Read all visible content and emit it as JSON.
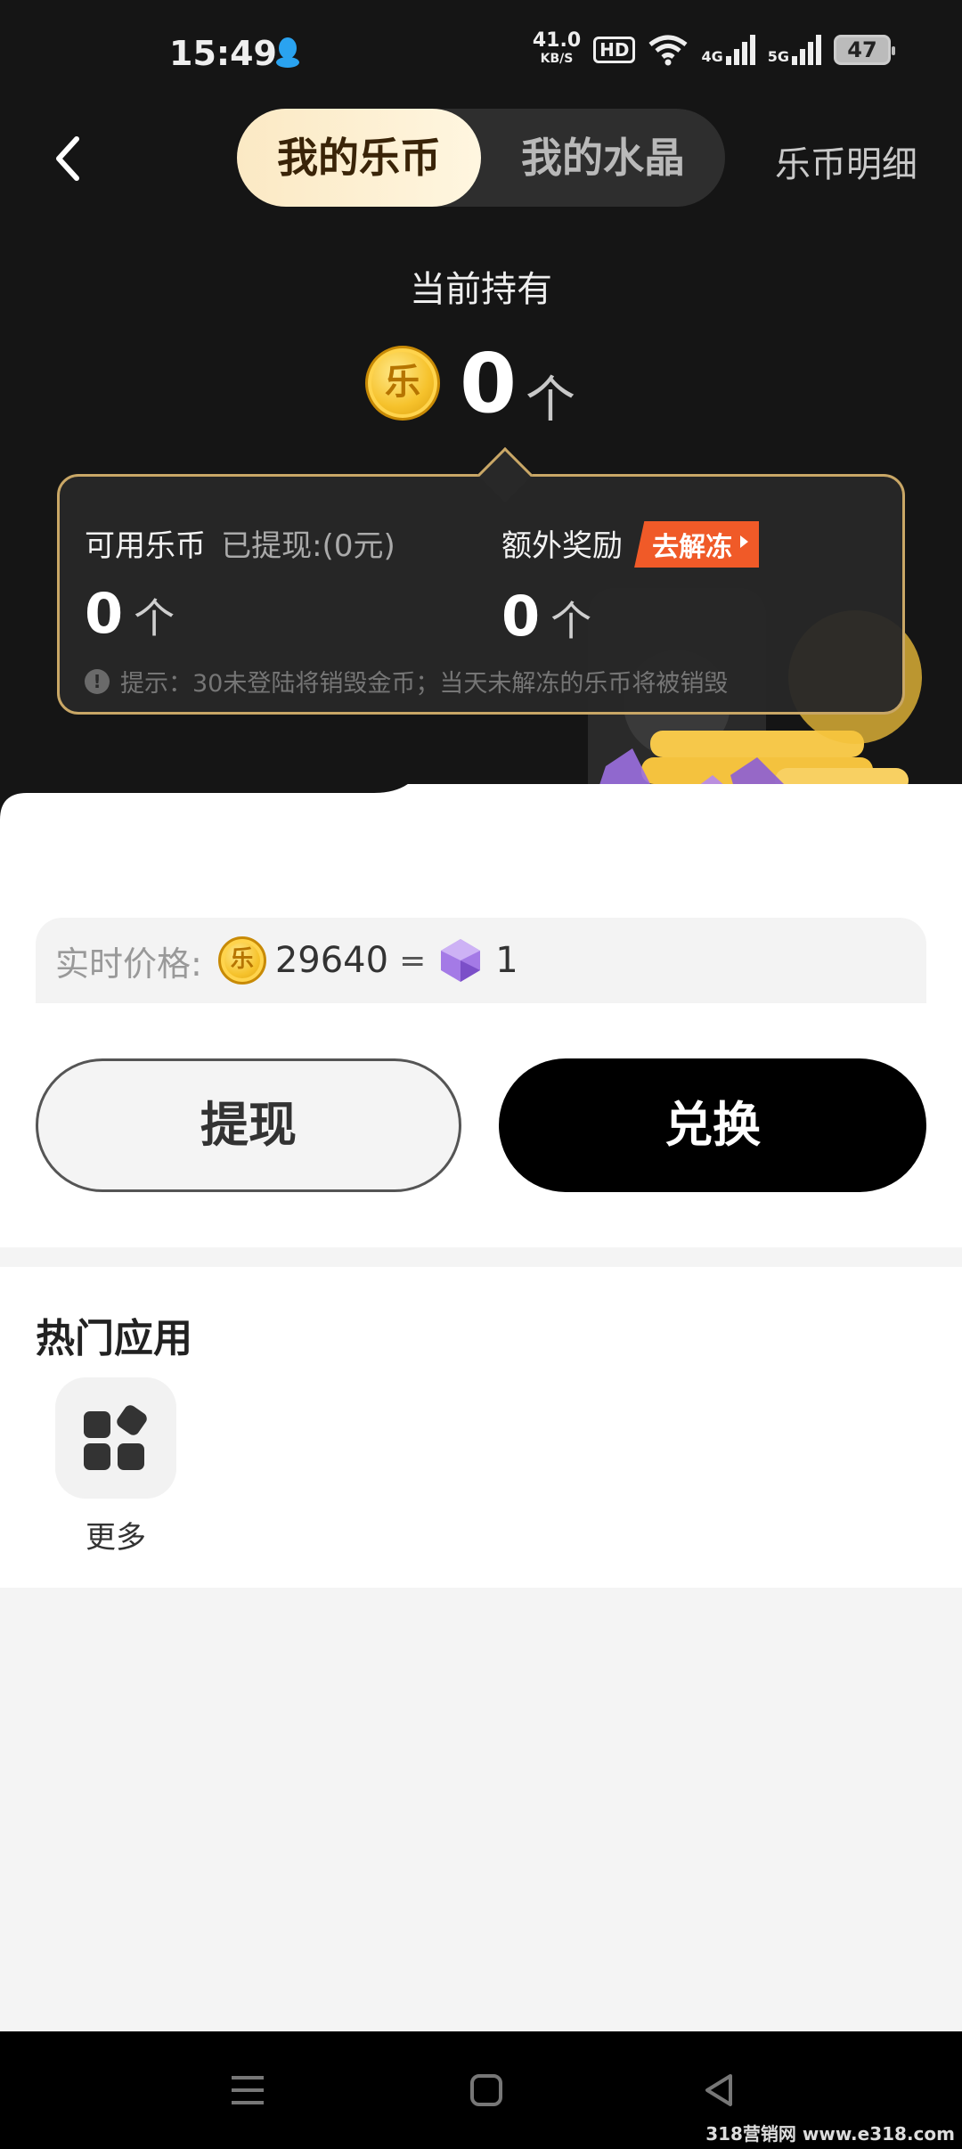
{
  "status_bar": {
    "time": "15:49",
    "speed": "41.0",
    "speed_unit": "KB/S",
    "hd": "HD",
    "net1": "4G",
    "net2": "5G",
    "battery": "47"
  },
  "header": {
    "tab_active": "我的乐币",
    "tab_inactive": "我的水晶",
    "detail_link": "乐币明细"
  },
  "holding": {
    "label": "当前持有",
    "coin_char": "乐",
    "amount": "0",
    "unit": "个"
  },
  "balance_card": {
    "available_label": "可用乐币",
    "withdrawn": "已提现:(0元)",
    "available_value": "0",
    "unit": "个",
    "extra_label": "额外奖励",
    "unfreeze_button": "去解冻",
    "extra_value": "0",
    "tip": "提示：30未登陆将销毁金币；当天未解冻的乐币将被销毁"
  },
  "rate": {
    "label": "实时价格:",
    "coin_amount": "29640",
    "equals": "=",
    "crystal_amount": "1"
  },
  "actions": {
    "withdraw": "提现",
    "exchange": "兑换"
  },
  "hot_apps": {
    "title": "热门应用",
    "items": [
      {
        "label": "更多",
        "icon": "grid-icon"
      }
    ]
  },
  "watermark": "318营销网 www.e318.com",
  "colors": {
    "accent_gold": "#c9a766",
    "unfreeze": "#f05a28",
    "dark_bg": "#151515"
  }
}
